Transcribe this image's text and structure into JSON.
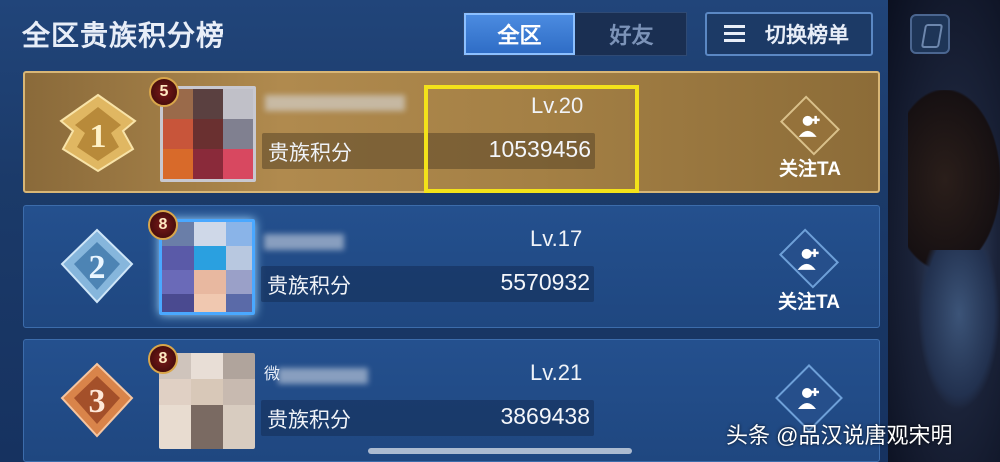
{
  "header": {
    "title": "全区贵族积分榜"
  },
  "tabs": [
    {
      "label": "全区",
      "active": true
    },
    {
      "label": "好友",
      "active": false
    }
  ],
  "switch_button": {
    "label": "切换榜单",
    "icon": "list-icon"
  },
  "rows": [
    {
      "rank": "1",
      "vip": "5",
      "name": "",
      "level": "Lv.20",
      "score_label": "贵族积分",
      "score": "10539456",
      "follow_label": "关注TA"
    },
    {
      "rank": "2",
      "vip": "8",
      "name": "",
      "level": "Lv.17",
      "score_label": "贵族积分",
      "score": "5570932",
      "follow_label": "关注TA"
    },
    {
      "rank": "3",
      "vip": "8",
      "name": "微",
      "level": "Lv.21",
      "score_label": "贵族积分",
      "score": "3869438",
      "follow_label": "关注TA"
    }
  ],
  "colors": {
    "highlight": "#f3e21a",
    "rank1": "#d9a64a",
    "rank2": "#7aa7d0",
    "rank3": "#c66a3a"
  },
  "watermark": "头条 @品汉说唐观宋明"
}
